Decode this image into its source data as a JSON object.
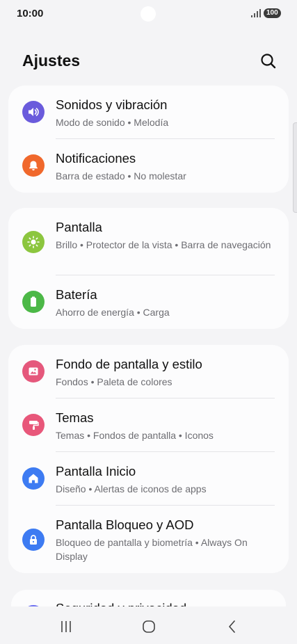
{
  "status_bar": {
    "time": "10:00",
    "battery": "100"
  },
  "header": {
    "title": "Ajustes"
  },
  "groups": [
    {
      "items": [
        {
          "title": "Sonidos y vibración",
          "subtitle": "Modo de sonido  •  Melodía",
          "icon": "volume-icon",
          "color": "#6a5bdc"
        },
        {
          "title": "Notificaciones",
          "subtitle": "Barra de estado  •  No molestar",
          "icon": "bell-icon",
          "color": "#f0682c"
        }
      ]
    },
    {
      "items": [
        {
          "title": "Pantalla",
          "subtitle": "Brillo  •  Protector de la vista  •  Barra de navegación",
          "icon": "sun-icon",
          "color": "#8cc63f"
        },
        {
          "title": "Batería",
          "subtitle": "Ahorro de energía  •  Carga",
          "icon": "battery-icon",
          "color": "#4cb847"
        }
      ]
    },
    {
      "items": [
        {
          "title": "Fondo de pantalla y estilo",
          "subtitle": "Fondos  •  Paleta de colores",
          "icon": "image-icon",
          "color": "#e5587c"
        },
        {
          "title": "Temas",
          "subtitle": "Temas  •  Fondos de pantalla  •  Iconos",
          "icon": "paint-roller-icon",
          "color": "#e8577a"
        },
        {
          "title": "Pantalla Inicio",
          "subtitle": "Diseño  •  Alertas de iconos de apps",
          "icon": "home-icon",
          "color": "#3d7bf2"
        },
        {
          "title": "Pantalla Bloqueo y AOD",
          "subtitle": "Bloqueo de pantalla y biometría  •  Always On Display",
          "icon": "lock-icon",
          "color": "#3d7bf2"
        }
      ]
    }
  ],
  "peek": {
    "title": "Seguridad y privacidad",
    "color": "#6b6ef0"
  }
}
